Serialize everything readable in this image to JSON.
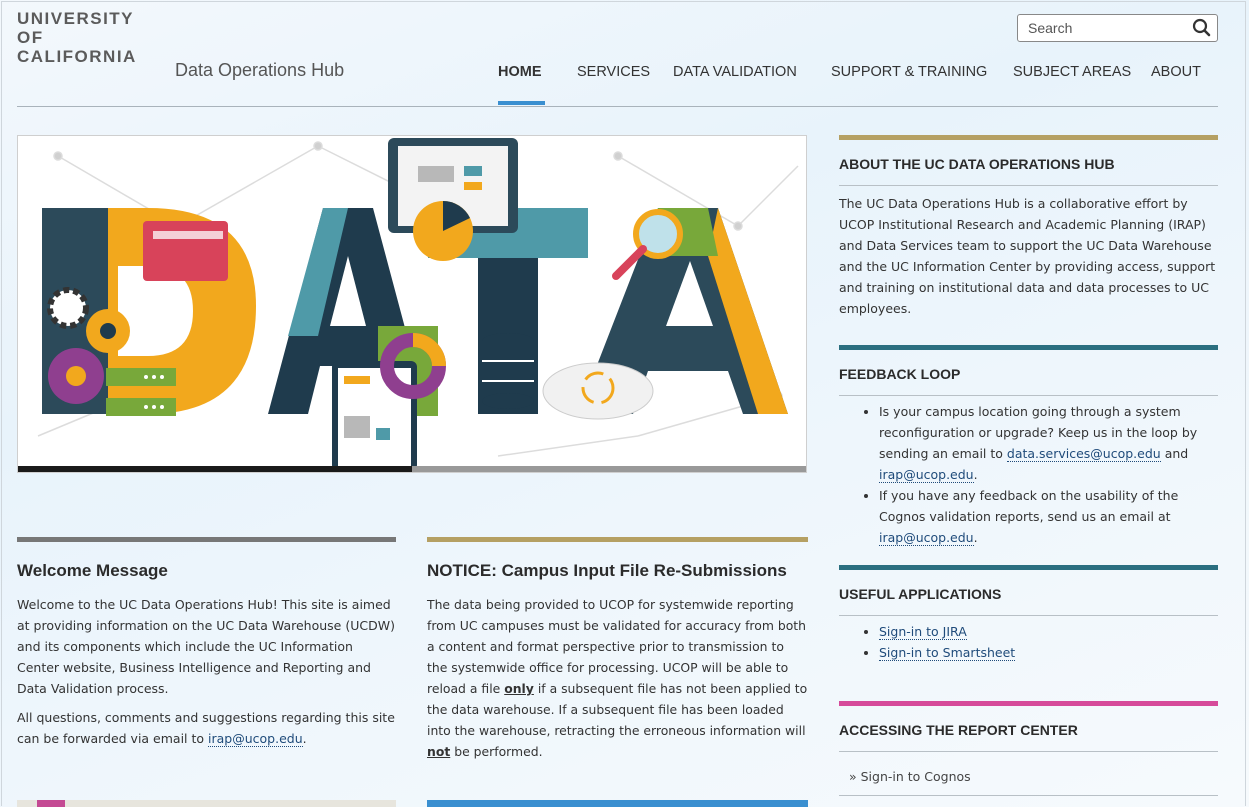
{
  "brand": {
    "logo_line1": "UNIVERSITY",
    "logo_line2": "OF",
    "logo_line3": "CALIFORNIA",
    "site_name": "Data Operations Hub"
  },
  "search": {
    "placeholder": "Search",
    "icon": "search-icon"
  },
  "nav": {
    "items": [
      "HOME",
      "SERVICES",
      "DATA VALIDATION",
      "SUPPORT & TRAINING",
      "SUBJECT AREAS",
      "ABOUT"
    ],
    "active": "HOME"
  },
  "hero": {
    "word": "DATA"
  },
  "welcome": {
    "title": "Welcome Message",
    "para1": "Welcome to the UC Data Operations Hub! This site is aimed at providing information on the UC Data Warehouse (UCDW) and its components which include the UC Information Center website, Business Intelligence and Reporting and Data Validation process.",
    "para2_prefix": "All questions, comments and suggestions regarding this site can be forwarded via email to ",
    "para2_link": "irap@ucop.edu",
    "para2_suffix": "."
  },
  "notice": {
    "title": "NOTICE: Campus Input File Re-Submissions",
    "text_a": "The data being provided to UCOP for systemwide reporting from UC campuses must be validated for accuracy from both a content and format perspective prior to transmission to the systemwide office for processing. UCOP will be able to reload a file ",
    "emph_only": "only",
    "text_b": " if a subsequent file has not been applied to the data warehouse. If a subsequent file has been loaded into the warehouse, retracting the erroneous information will ",
    "emph_not": "not",
    "text_c": " be performed."
  },
  "about": {
    "title": "ABOUT THE UC DATA OPERATIONS HUB",
    "text": "The UC Data Operations Hub is a collaborative effort by UCOP Institutional Research and Academic Planning (IRAP) and Data Services team to support the UC Data Warehouse and the UC Information Center by providing access, support and training on institutional data and data processes to UC employees."
  },
  "feedback": {
    "title": "FEEDBACK LOOP",
    "item1_text": "Is your campus location going through a system reconfiguration or upgrade? Keep us in the loop by sending an email to ",
    "item1_link1": "data.services@ucop.edu",
    "item1_mid": " and ",
    "item1_link2": "irap@ucop.edu",
    "item1_end": ".",
    "item2_text": "If you have any feedback on the usability of the Cognos validation reports, send us an email at ",
    "item2_link": "irap@ucop.edu",
    "item2_end": "."
  },
  "apps": {
    "title": "USEFUL APPLICATIONS",
    "links": [
      "Sign-in to JIRA",
      "Sign-in to Smartsheet"
    ]
  },
  "report": {
    "title": "ACCESSING THE REPORT CENTER",
    "link": "» Sign-in to Cognos"
  },
  "colors": {
    "gold": "#b5a063",
    "teal": "#2b6f80",
    "magenta": "#d64b9a",
    "gray": "#777777",
    "blue": "#3a8fd0"
  }
}
